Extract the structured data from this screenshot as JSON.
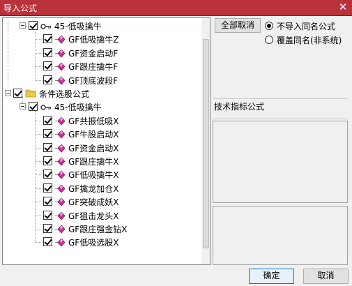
{
  "window": {
    "title": "导入公式",
    "close_glyph": "✕"
  },
  "tree": {
    "nodes": [
      {
        "label": "45-低吸擒牛",
        "level": 1,
        "icon": "key-icon",
        "checked": true,
        "expander": true
      },
      {
        "label": "GF低吸擒牛Z",
        "level": 2,
        "icon": "diamond-icon",
        "checked": true
      },
      {
        "label": "GF资金启动F",
        "level": 2,
        "icon": "diamond-icon",
        "checked": true
      },
      {
        "label": "GF跟庄擒牛F",
        "level": 2,
        "icon": "diamond-icon",
        "checked": true
      },
      {
        "label": "GF顶底波段F",
        "level": 2,
        "icon": "diamond-icon",
        "checked": true
      },
      {
        "label": "条件选股公式",
        "level": 0,
        "icon": "folder-icon",
        "checked": true,
        "expander": true
      },
      {
        "label": "45-低吸擒牛",
        "level": 1,
        "icon": "key-icon",
        "checked": true,
        "expander": true
      },
      {
        "label": "GF共振低吸X",
        "level": 2,
        "icon": "diamond-icon",
        "checked": true
      },
      {
        "label": "GF牛股启动X",
        "level": 2,
        "icon": "diamond-icon",
        "checked": true
      },
      {
        "label": "GF资金启动X",
        "level": 2,
        "icon": "diamond-icon",
        "checked": true
      },
      {
        "label": "GF跟庄擒牛X",
        "level": 2,
        "icon": "diamond-icon",
        "checked": true
      },
      {
        "label": "GF低吸擒牛X",
        "level": 2,
        "icon": "diamond-icon",
        "checked": true
      },
      {
        "label": "GF擒龙加仓X",
        "level": 2,
        "icon": "diamond-icon",
        "checked": true
      },
      {
        "label": "GF突破成妖X",
        "level": 2,
        "icon": "diamond-icon",
        "checked": true
      },
      {
        "label": "GF狙击龙头X",
        "level": 2,
        "icon": "diamond-icon",
        "checked": true
      },
      {
        "label": "GF跟庄强金钻X",
        "level": 2,
        "icon": "diamond-icon",
        "checked": true
      },
      {
        "label": "GF低吸选股X",
        "level": 2,
        "icon": "diamond-icon",
        "checked": true
      }
    ]
  },
  "controls": {
    "cancel_all_label": "全部取消",
    "radio_options": [
      {
        "label": "不导入同名公式",
        "checked": true
      },
      {
        "label": "覆盖同名(非系统)",
        "checked": false
      }
    ],
    "tech_label": "技术指标公式",
    "ok_label": "确定",
    "cancel_label": "取消"
  },
  "colors": {
    "title_bar": "#b9323a",
    "diamond": "#cc2f9a",
    "folder": "#f2c94c"
  }
}
